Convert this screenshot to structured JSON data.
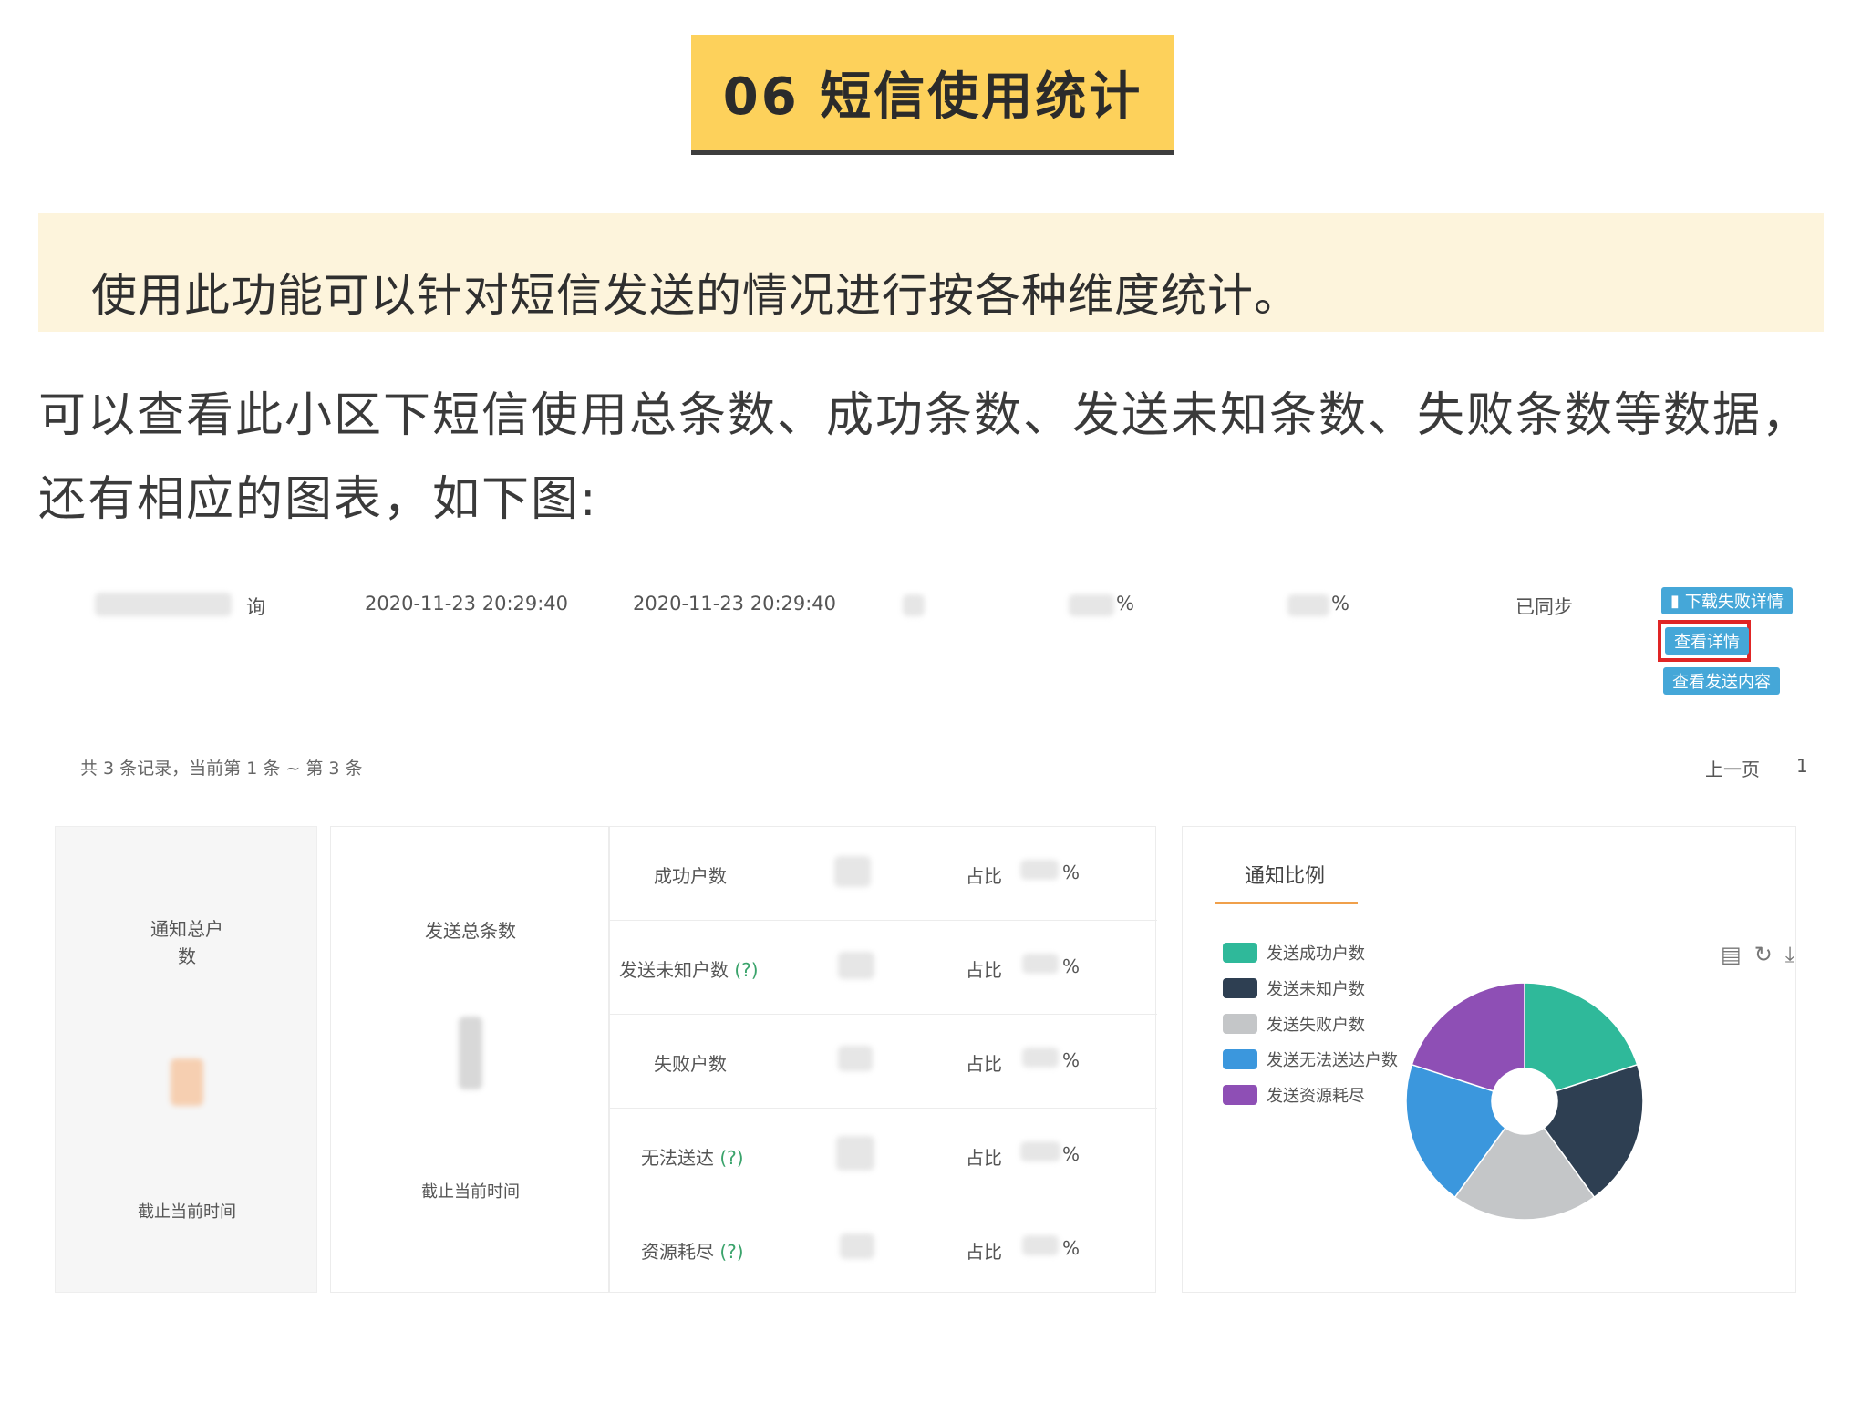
{
  "heading": "06 短信使用统计",
  "intro": "使用此功能可以针对短信发送的情况进行按各种维度统计。",
  "paragraph": "可以查看此小区下短信使用总条数、成功条数、发送未知条数、失败条数等数据，还有相应的图表，如下图:",
  "screenshot": {
    "row": {
      "name_suffix": "询",
      "time1": "2020-11-23 20:29:40",
      "time2": "2020-11-23 20:29:40",
      "pct1": "%",
      "pct2": "%",
      "status": "已同步",
      "btn_download": "下载失败详情",
      "btn_detail": "查看详情",
      "btn_content": "查看发送内容"
    },
    "pager": {
      "summary": "共 3 条记录，当前第 1 条 ~ 第 3 条",
      "prev": "上一页",
      "page": "1"
    },
    "card1": {
      "title_line1": "通知总户",
      "title_line2": "数",
      "footer": "截止当前时间"
    },
    "card2": {
      "title": "发送总条数",
      "footer": "截止当前时间"
    },
    "stats": [
      {
        "label": "成功户数",
        "q": "",
        "ratio": "占比",
        "pct": "%"
      },
      {
        "label": "发送未知户数",
        "q": "(?)",
        "ratio": "占比",
        "pct": "%"
      },
      {
        "label": "失败户数",
        "q": "",
        "ratio": "占比",
        "pct": "%"
      },
      {
        "label": "无法送达",
        "q": "(?)",
        "ratio": "占比",
        "pct": "%"
      },
      {
        "label": "资源耗尽",
        "q": "(?)",
        "ratio": "占比",
        "pct": "%"
      }
    ],
    "chart_card": {
      "tab": "通知比例",
      "icons": [
        "document-icon",
        "refresh-icon",
        "download-icon"
      ]
    }
  },
  "chart_data": {
    "type": "pie",
    "title": "",
    "donut": true,
    "categories": [
      "发送成功户数",
      "发送未知户数",
      "发送失败户数",
      "发送无法送达户数",
      "发送资源耗尽"
    ],
    "values": [
      20,
      20,
      20,
      20,
      20
    ],
    "colors": [
      "#2fb99a",
      "#2e3f52",
      "#c4c6c8",
      "#3b97dd",
      "#8e4fb5"
    ],
    "legend": "left"
  }
}
